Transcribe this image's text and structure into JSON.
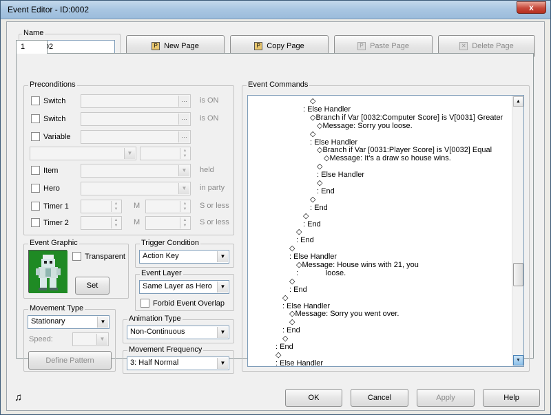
{
  "window": {
    "title": "Event Editor - ID:0002",
    "close_glyph": "x"
  },
  "name_section": {
    "label": "Name",
    "value": "EV0002"
  },
  "toolbar": {
    "new_page": "New Page",
    "copy_page": "Copy Page",
    "paste_page": "Paste Page",
    "delete_page": "Delete Page"
  },
  "tabs": [
    {
      "label": "1"
    }
  ],
  "preconditions": {
    "title": "Preconditions",
    "switch1": {
      "label": "Switch",
      "suffix": "is ON"
    },
    "switch2": {
      "label": "Switch",
      "suffix": "is ON"
    },
    "variable": {
      "label": "Variable"
    },
    "item": {
      "label": "Item",
      "suffix": "held"
    },
    "hero": {
      "label": "Hero",
      "suffix": "in party"
    },
    "timer1": {
      "label": "Timer 1",
      "unit_m": "M",
      "unit_s": "S or less"
    },
    "timer2": {
      "label": "Timer 2",
      "unit_m": "M",
      "unit_s": "S or less"
    }
  },
  "event_graphic": {
    "title": "Event Graphic",
    "transparent_label": "Transparent",
    "set_button": "Set"
  },
  "trigger_condition": {
    "title": "Trigger Condition",
    "value": "Action Key"
  },
  "event_layer": {
    "title": "Event Layer",
    "value": "Same Layer as Hero",
    "forbid_overlap": "Forbid Event Overlap"
  },
  "movement_type": {
    "title": "Movement Type",
    "value": "Stationary",
    "speed_label": "Speed:",
    "define_pattern": "Define Pattern"
  },
  "animation_type": {
    "title": "Animation Type",
    "value": "Non-Continuous"
  },
  "movement_frequency": {
    "title": "Movement Frequency",
    "value": "3: Half Normal"
  },
  "event_commands": {
    "title": "Event Commands",
    "lines": [
      "◇",
      ": Else Handler",
      "◇Branch if Var [0032:Computer Score] is V[0031] Greater",
      "◇Message: Sorry you loose.",
      "◇",
      ": Else Handler",
      "◇Branch if Var [0031:Player Score] is V[0032] Equal",
      "◇Message: It's a draw so house wins.",
      "◇",
      ": Else Handler",
      "◇",
      ": End",
      "◇",
      ": End",
      "◇",
      ": End",
      "◇",
      ": End",
      "◇",
      ": Else Handler",
      "◇Message: House wins with 21, you",
      ":             loose.",
      "◇",
      ": End",
      "◇",
      ": Else Handler",
      "◇Message: Sorry you went over.",
      "◇",
      ": End",
      "◇",
      ": End",
      "◇",
      ": Else Handler"
    ]
  },
  "footer": {
    "music_icon": "♫",
    "ok": "OK",
    "cancel": "Cancel",
    "apply": "Apply",
    "help": "Help"
  }
}
